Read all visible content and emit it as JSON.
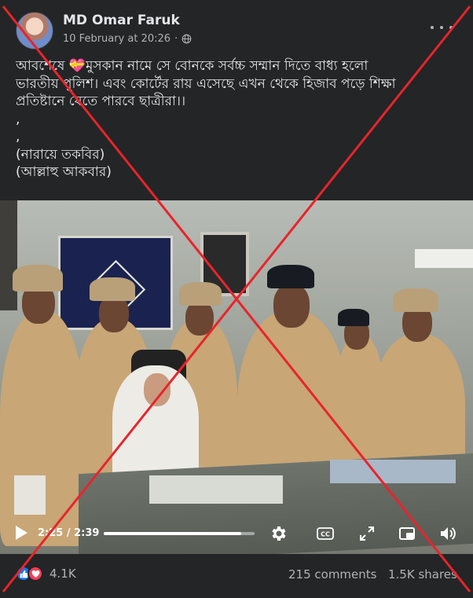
{
  "post": {
    "author": "MD Omar Faruk",
    "date": "10 February at 20:26",
    "privacy_separator": "·",
    "text_lines": [
      "আবশেষে 💝মুসকান নামে সে বোনকে সর্বচ্চ সম্মান দিতে বাধ্য হলো",
      "ভারতীয় পুলিশ। এবং কোর্টের রায় এসেছে এখন থেকে হিজাব পড়ে শিক্ষা",
      "প্রতিষ্টানে যেতে পারবে ছাত্রীরা।।",
      ",",
      ",",
      "(নারায়ে তকবির)",
      "(আল্লাহু আকবার)"
    ]
  },
  "video": {
    "time": "2:25 / 2:39",
    "progress_fraction": 0.912
  },
  "stats": {
    "reactions": "4.1K",
    "comments": "215 comments",
    "shares": "1.5K shares"
  },
  "icons": {
    "privacy": "globe-icon",
    "more": "more-options-icon",
    "play": "play-icon",
    "settings": "gear-icon",
    "captions": "closed-captions-icon",
    "fullscreen": "fullscreen-icon",
    "pip": "picture-in-picture-icon",
    "volume": "volume-icon",
    "like": "like-icon",
    "love": "love-icon"
  },
  "colors": {
    "background": "#242526",
    "text_primary": "#e4e6eb",
    "text_secondary": "#b0b3b8",
    "cross_mark": "#e8242c",
    "like": "#1877f2",
    "love": "#f33e58"
  }
}
